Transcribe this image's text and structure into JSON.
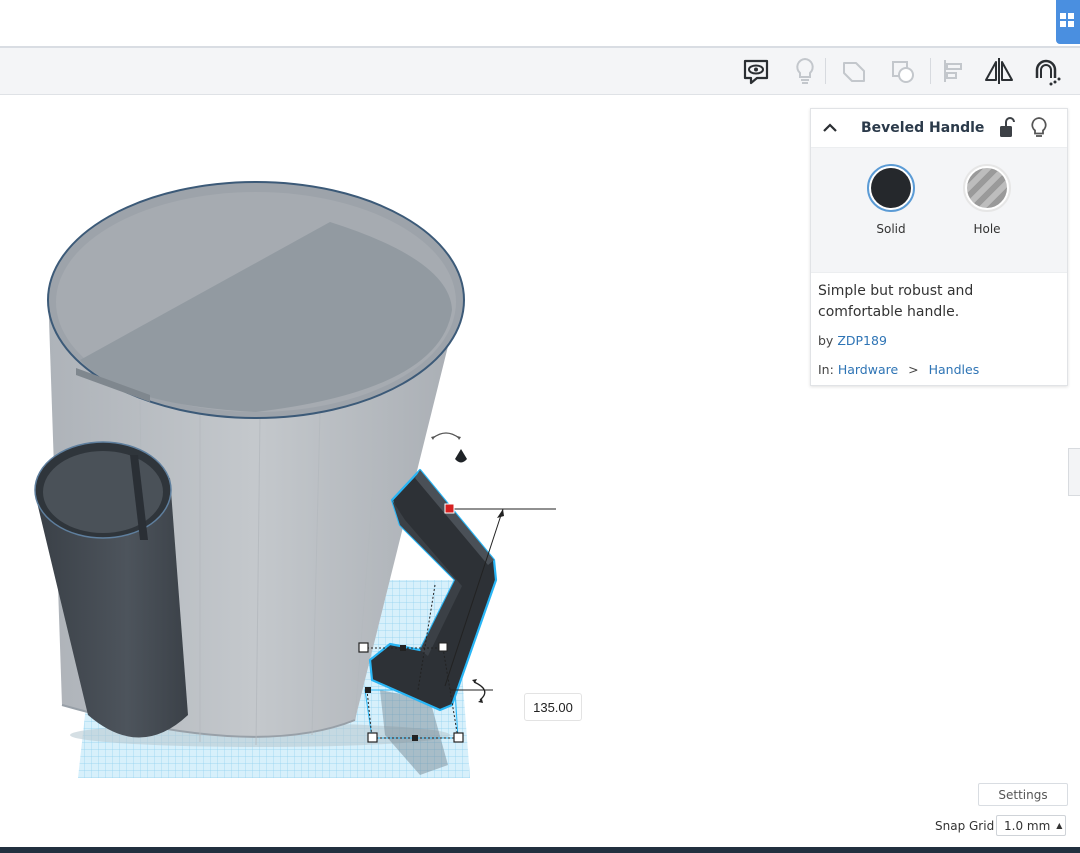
{
  "toolbar": {
    "icons": [
      "notes-icon",
      "lightbulb-icon",
      "group-icon",
      "ungroup-icon",
      "align-icon",
      "mirror-icon",
      "magnet-icon"
    ]
  },
  "viewport": {
    "dimension_value": "135.00"
  },
  "inspector": {
    "title": "Beveled Handle",
    "solid_label": "Solid",
    "hole_label": "Hole",
    "description": "Simple but robust and comfortable handle.",
    "by_prefix": "by",
    "author": "ZDP189",
    "in_prefix": "In:",
    "category": "Hardware",
    "separator": ">",
    "subcategory": "Handles",
    "solid_color": "#25282c"
  },
  "footer": {
    "settings_label": "Settings",
    "snap_grid_label": "Snap Grid",
    "snap_grid_value": "1.0 mm",
    "snap_caret": "▲"
  },
  "colors": {
    "accent": "#4a8fe0",
    "selection": "#29b6f6",
    "link": "#2e74b5"
  }
}
